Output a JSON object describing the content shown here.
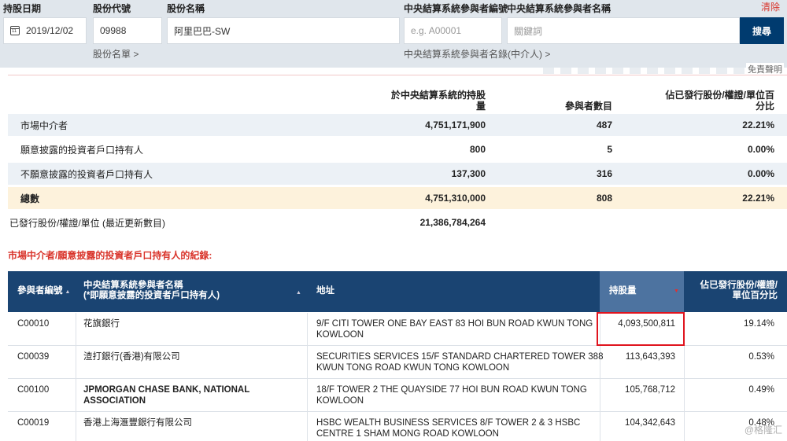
{
  "search": {
    "labels": {
      "date": "持股日期",
      "code": "股份代號",
      "name": "股份名稱",
      "participant_id": "中央結算系統參與者編號",
      "participant_name": "中央結算系統參與者名稱"
    },
    "date_value": "2019/12/02",
    "code_value": "09988",
    "name_value": "阿里巴巴-SW",
    "participant_id_placeholder": "e.g. A00001",
    "participant_name_placeholder": "關鍵詞",
    "stock_list_link": "股份名單 >",
    "participant_list_link": "中央結算系統參與者名錄(中介人) >",
    "clear_label": "清除",
    "search_label": "搜尋",
    "disclaimer": "免責聲明"
  },
  "summary": {
    "headers": {
      "holding": "於中央結算系統的持股量",
      "participants": "參與者數目",
      "percent": "佔已發行股份/權證/單位百分比"
    },
    "rows": [
      {
        "label": "市場中介者",
        "holding": "4,751,171,900",
        "participants": "487",
        "percent": "22.21%"
      },
      {
        "label": "願意披露的投資者戶口持有人",
        "holding": "800",
        "participants": "5",
        "percent": "0.00%"
      },
      {
        "label": "不願意披露的投資者戶口持有人",
        "holding": "137,300",
        "participants": "316",
        "percent": "0.00%"
      },
      {
        "label": "總數",
        "holding": "4,751,310,000",
        "participants": "808",
        "percent": "22.21%"
      }
    ],
    "issued": {
      "label": "已發行股份/權證/單位 (最近更新數目)",
      "value": "21,386,784,264"
    }
  },
  "records": {
    "title": "市場中介者/願意披露的投資者戶口持有人的紀錄:",
    "headers": {
      "id": "參與者編號",
      "name_line1": "中央結算系統參與者名稱",
      "name_line2": "(*即願意披露的投資者戶口持有人)",
      "address": "地址",
      "holding": "持股量",
      "percent_line1": "佔已發行股份/權證/",
      "percent_line2": "單位百分比"
    },
    "rows": [
      {
        "id": "C00010",
        "name1": "花旗銀行",
        "name2": "",
        "addr1": "9/F CITI TOWER ONE BAY EAST 83 HOI BUN ROAD KWUN TONG",
        "addr2": "KOWLOON",
        "holding": "4,093,500,811",
        "percent": "19.14%"
      },
      {
        "id": "C00039",
        "name1": "渣打銀行(香港)有限公司",
        "name2": "",
        "addr1": "SECURITIES SERVICES 15/F STANDARD CHARTERED TOWER 388",
        "addr2": "KWUN TONG ROAD KWUN TONG KOWLOON",
        "holding": "113,643,393",
        "percent": "0.53%"
      },
      {
        "id": "C00100",
        "name1": "JPMORGAN CHASE BANK, NATIONAL",
        "name2": "ASSOCIATION",
        "addr1": "18/F TOWER 2 THE QUAYSIDE 77 HOI BUN ROAD KWUN TONG",
        "addr2": "KOWLOON",
        "holding": "105,768,712",
        "percent": "0.49%"
      },
      {
        "id": "C00019",
        "name1": "香港上海滙豐銀行有限公司",
        "name2": "",
        "addr1": "HSBC WEALTH BUSINESS SERVICES 8/F TOWER 2 & 3 HSBC",
        "addr2": "CENTRE 1 SHAM MONG ROAD KOWLOON",
        "holding": "104,342,643",
        "percent": "0.48%"
      }
    ]
  },
  "watermark": "@格隆汇"
}
